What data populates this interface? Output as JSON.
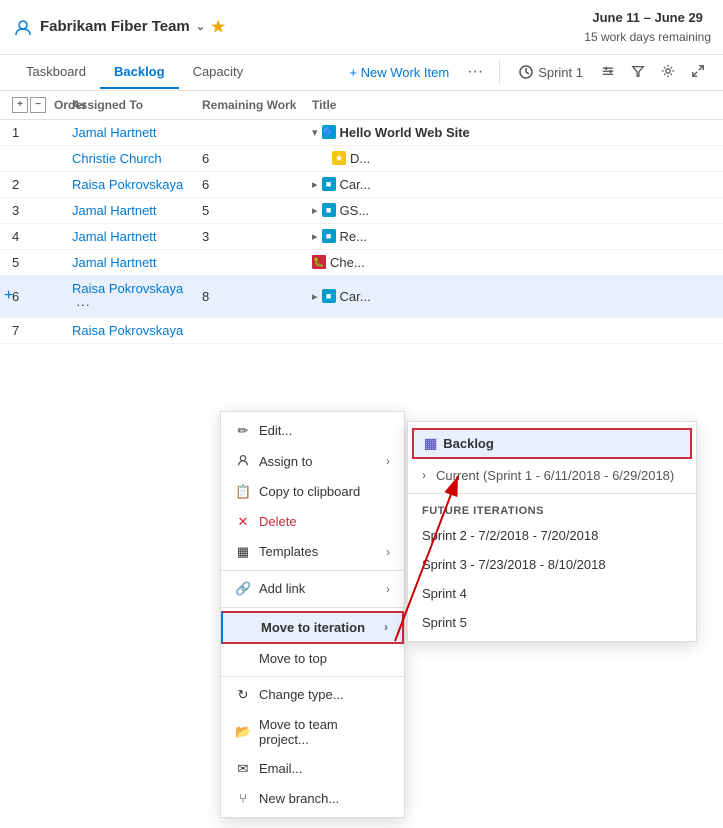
{
  "header": {
    "team_name": "Fabrikam Fiber Team",
    "chevron": "⌄",
    "star": "★",
    "date_range": "June 11 – June 29",
    "days_remaining": "15 work days remaining",
    "divider": true
  },
  "nav": {
    "tabs": [
      {
        "label": "Taskboard",
        "active": false
      },
      {
        "label": "Backlog",
        "active": true
      },
      {
        "label": "Capacity",
        "active": false
      }
    ],
    "new_item_label": "+ New Work Item",
    "more_label": "···",
    "sprint_label": "Sprint 1",
    "settings_icon": "⚙",
    "filter_icon": "▽",
    "expand_icon": "⤢"
  },
  "table": {
    "col_headers": {
      "order": "Order",
      "assigned_to": "Assigned To",
      "remaining_work": "Remaining Work",
      "title": "Title"
    },
    "rows": [
      {
        "order": "1",
        "assigned": "Jamal Hartnett",
        "remaining": "",
        "title": "Hello World Web Site",
        "indent": 0,
        "icon": "blue",
        "bold": true
      },
      {
        "order": "",
        "assigned": "Christie Church",
        "remaining": "6",
        "title": "D...",
        "indent": 1,
        "icon": "yellow"
      },
      {
        "order": "2",
        "assigned": "Raisa Pokrovskaya",
        "remaining": "6",
        "title": "Car...",
        "indent": 0,
        "icon": "blue"
      },
      {
        "order": "3",
        "assigned": "Jamal Hartnett",
        "remaining": "5",
        "title": "GS...",
        "indent": 0,
        "icon": "blue"
      },
      {
        "order": "4",
        "assigned": "Jamal Hartnett",
        "remaining": "3",
        "title": "Re...",
        "indent": 0,
        "icon": "blue"
      },
      {
        "order": "5",
        "assigned": "Jamal Hartnett",
        "remaining": "",
        "title": "Che...",
        "indent": 0,
        "icon": "red"
      },
      {
        "order": "6",
        "assigned": "Raisa Pokrovskaya",
        "remaining": "8",
        "title": "Car...",
        "indent": 0,
        "icon": "blue",
        "highlighted": true,
        "ellipsis": true
      },
      {
        "order": "7",
        "assigned": "Raisa Pokrovskaya",
        "remaining": "",
        "title": "",
        "indent": 0,
        "icon": ""
      }
    ]
  },
  "context_menu": {
    "items": [
      {
        "label": "Edit...",
        "icon": "✏",
        "has_arrow": false
      },
      {
        "label": "Assign to",
        "icon": "👤",
        "has_arrow": true
      },
      {
        "label": "Copy to clipboard",
        "icon": "📋",
        "has_arrow": false
      },
      {
        "label": "Delete",
        "icon": "✕",
        "has_arrow": false,
        "danger": true
      },
      {
        "label": "Templates",
        "icon": "▦",
        "has_arrow": true
      },
      {
        "label": "Add link",
        "icon": "🔗",
        "has_arrow": true
      },
      {
        "label": "Move to iteration",
        "icon": "",
        "has_arrow": true,
        "highlighted": true
      },
      {
        "label": "Move to top",
        "icon": "",
        "has_arrow": false
      },
      {
        "label": "Change type...",
        "icon": "↻",
        "has_arrow": false
      },
      {
        "label": "Move to team project...",
        "icon": "📂",
        "has_arrow": false
      },
      {
        "label": "Email...",
        "icon": "✉",
        "has_arrow": false
      },
      {
        "label": "New branch...",
        "icon": "⑂",
        "has_arrow": false
      }
    ]
  },
  "submenu": {
    "backlog_label": "Backlog",
    "backlog_icon": "▦",
    "current_label": "Current (Sprint 1 - 6/11/2018 - 6/29/2018)",
    "future_header": "FUTURE ITERATIONS",
    "future_items": [
      "Sprint 2 - 7/2/2018 - 7/20/2018",
      "Sprint 3 - 7/23/2018 - 8/10/2018",
      "Sprint 4",
      "Sprint 5"
    ]
  }
}
